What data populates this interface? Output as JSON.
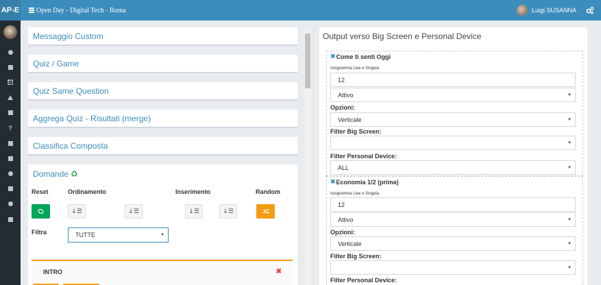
{
  "header": {
    "logo": "AP-E",
    "title": "Open Day - Digital Tech - Roma",
    "user_name": "Luigi SUSANNA"
  },
  "sidebar": {
    "icons": [
      "dashboard-icon",
      "edit-icon",
      "grid-icon",
      "warning-icon",
      "book-icon",
      "question-icon",
      "clone-icon",
      "square-icon",
      "users-icon",
      "tv-icon",
      "share-icon",
      "file-icon"
    ],
    "glyphs": [
      "",
      "",
      "",
      "",
      "",
      "?",
      "",
      "",
      "",
      "",
      "",
      ""
    ]
  },
  "panels": [
    "Messaggio Custom",
    "Quiz / Game",
    "Quiz Same Question",
    "Aggrega Quiz - Risultati (merge)",
    "Classifica Composta"
  ],
  "domande": {
    "title": "Domande",
    "recycle_glyph": "♻",
    "col_reset": "Reset",
    "col_ordinamento": "Ordinamento",
    "col_inserimento": "Inserimento",
    "col_random": "Random",
    "filtra_label": "Filtra",
    "filtra_value": "TUTTE",
    "intro_label": "INTRO",
    "intro_remove": "✖"
  },
  "output": {
    "title": "Output verso Big Screen e Personal Device",
    "widgets": [
      {
        "title": "Come ti senti Oggi",
        "subtitle": "Istogramma Live e Singola",
        "value": "12",
        "status": "Attivo",
        "opzioni_label": "Opzioni:",
        "opzioni_value": "Verticale",
        "filter_big_label": "Filter Big Screen:",
        "filter_big_value": "",
        "filter_pd_label": "Filter Personal Device:",
        "filter_pd_value": "ALL"
      },
      {
        "title": "Economia 1/2 (prima)",
        "subtitle": "Istogramma Live e Singola",
        "value": "12",
        "status": "Attivo",
        "opzioni_label": "Opzioni:",
        "opzioni_value": "Verticale",
        "filter_big_label": "Filter Big Screen:",
        "filter_big_value": "",
        "filter_pd_label": "Filter Personal Device:"
      }
    ]
  },
  "colors": {
    "header": "#3c8dbc",
    "sidebar": "#222d32",
    "green": "#00a65a",
    "orange": "#f39c12",
    "danger": "#dd4b39"
  }
}
